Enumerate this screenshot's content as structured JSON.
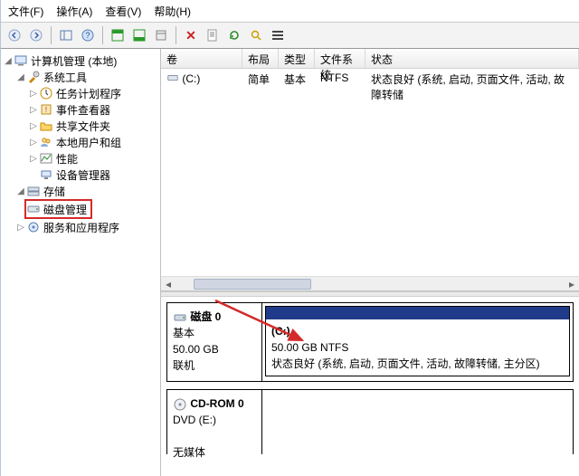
{
  "menu": {
    "file": "文件(F)",
    "action": "操作(A)",
    "view": "查看(V)",
    "help": "帮助(H)"
  },
  "tree": {
    "root": "计算机管理 (本地)",
    "systools": "系统工具",
    "systools_children": {
      "task": "任务计划程序",
      "event": "事件查看器",
      "shared": "共享文件夹",
      "users": "本地用户和组",
      "perf": "性能",
      "devmgr": "设备管理器"
    },
    "storage": "存储",
    "diskmgmt": "磁盘管理",
    "services": "服务和应用程序"
  },
  "grid": {
    "headers": {
      "volume": "卷",
      "layout": "布局",
      "type": "类型",
      "fs": "文件系统",
      "status": "状态"
    },
    "row": {
      "volume": "(C:)",
      "layout": "简单",
      "type": "基本",
      "fs": "NTFS",
      "status": "状态良好 (系统, 启动, 页面文件, 活动, 故障转储"
    }
  },
  "disk0": {
    "title": "磁盘 0",
    "kind": "基本",
    "size": "50.00 GB",
    "online": "联机",
    "vol_name": "(C:)",
    "vol_size": "50.00 GB NTFS",
    "vol_status": "状态良好 (系统, 启动, 页面文件, 活动, 故障转储, 主分区)"
  },
  "cdrom": {
    "title": "CD-ROM 0",
    "drive": "DVD (E:)",
    "media": "无媒体"
  }
}
